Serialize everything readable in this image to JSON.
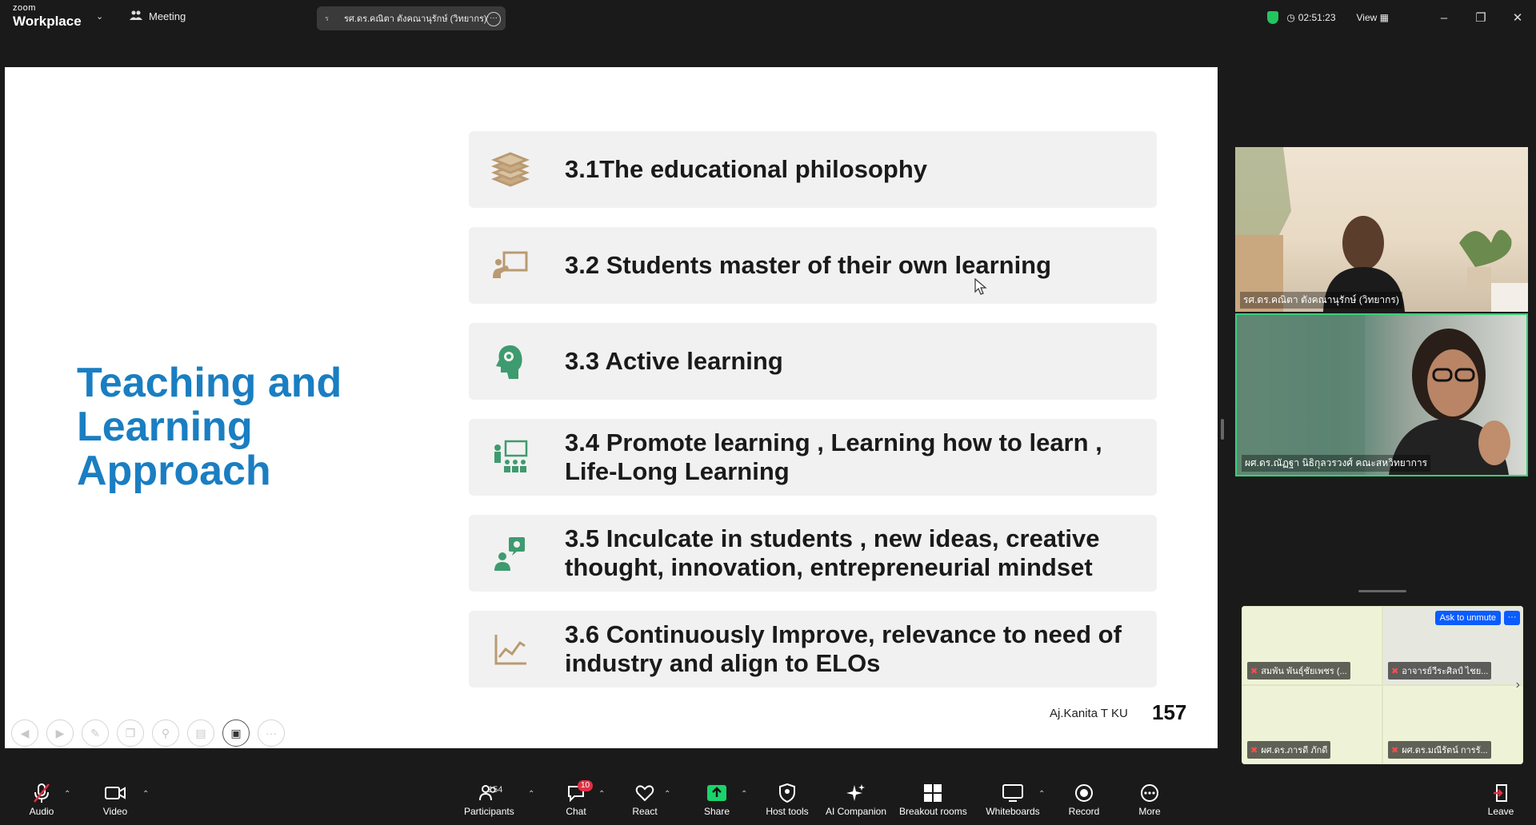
{
  "titlebar": {
    "brand_small": "zoom",
    "brand_large": "Workplace",
    "meeting_label": "Meeting",
    "active_speaker": "รศ.ดร.คณิตา ตังคณานุรักษ์ (วิทยากร)'",
    "timer": "02:51:23",
    "view_label": "View"
  },
  "slide": {
    "title": "Teaching and Learning Approach",
    "items": [
      {
        "text": "3.1The educational philosophy",
        "icon": "books-icon"
      },
      {
        "text": "3.2 Students master of their own learning",
        "icon": "teacher-board-icon"
      },
      {
        "text": "3.3 Active learning",
        "icon": "head-gears-icon"
      },
      {
        "text": "3.4 Promote learning , Learning how to learn , Life-Long Learning",
        "icon": "classroom-icon"
      },
      {
        "text": "3.5 Inculcate in students , new ideas, creative thought, innovation, entrepreneurial mindset",
        "icon": "idea-person-icon"
      },
      {
        "text": "3.6 Continuously Improve, relevance to need of industry and align to ELOs",
        "icon": "trend-chart-icon"
      }
    ],
    "footer": "Aj.Kanita T KU",
    "page_number": "157"
  },
  "videos": {
    "speaker1": "รศ.ดร.คณิตา ตังคณานุรักษ์ (วิทยากร)",
    "speaker2": "ผศ.ดร.ณัฏฐา นิธิกุลวรวงศ์ คณะสหวิทยาการ"
  },
  "gallery": {
    "ask_to_unmute": "Ask to unmute",
    "more": "···",
    "tiles": [
      "สมพัน พันธุ์ชัยเพชร (...",
      "อาจารย์วีระศิลป์ ไชย...",
      "ผศ.ดร.ภารดี ภักดี",
      "ผศ.ดร.มณีรัตน์ การรั..."
    ]
  },
  "toolbar": {
    "audio": "Audio",
    "video": "Video",
    "participants": "Participants",
    "participants_count": "154",
    "chat": "Chat",
    "chat_badge": "10",
    "react": "React",
    "share": "Share",
    "host_tools": "Host tools",
    "ai_companion": "AI Companion",
    "breakout_rooms": "Breakout rooms",
    "whiteboards": "Whiteboards",
    "record": "Record",
    "more": "More",
    "leave": "Leave"
  },
  "colors": {
    "accent_title": "#1a7ec2",
    "share_green": "#1ad36b",
    "active_border": "#38d078",
    "badge_red": "#e02f44"
  }
}
